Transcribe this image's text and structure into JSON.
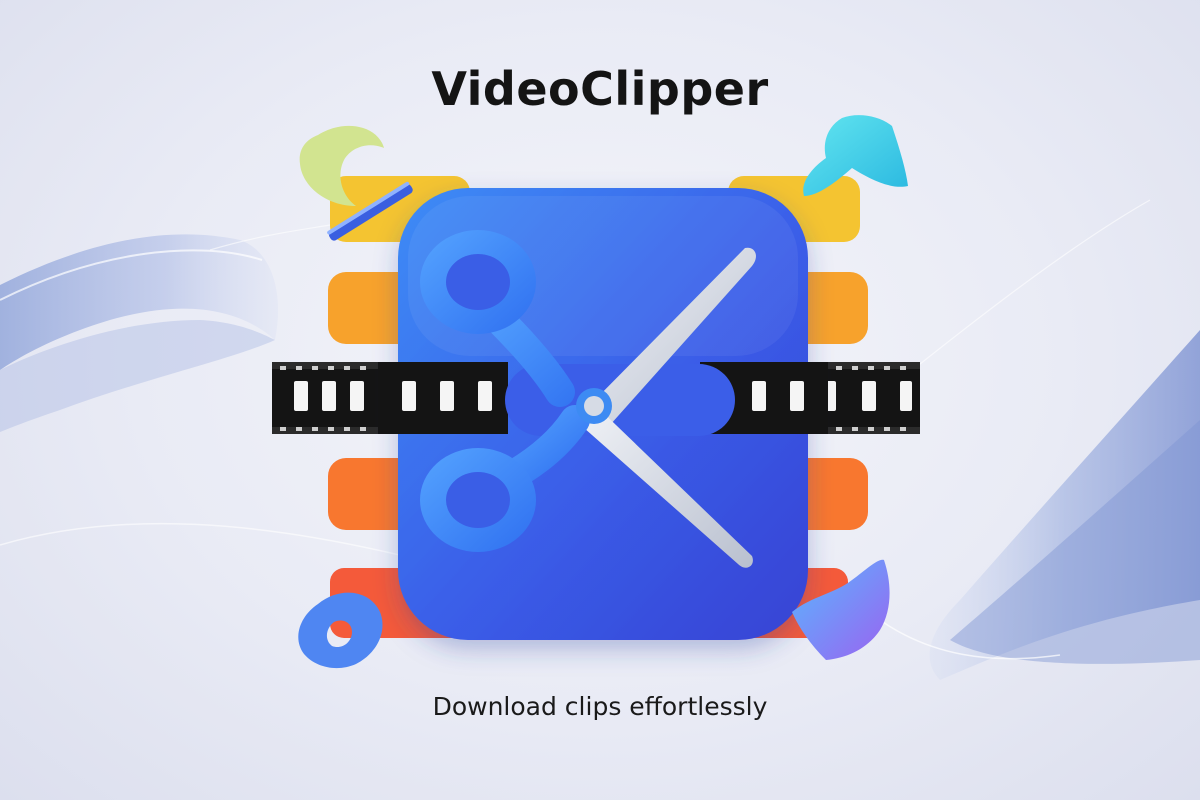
{
  "app": {
    "title": "VideoClipper",
    "tagline": "Download clips effortlessly"
  },
  "icons": {
    "logo": "scissors-cutting-film-strip-icon",
    "decor_top_left": "crescent-shape-icon",
    "decor_top_right": "bowtie-shape-icon",
    "decor_bottom_left": "ring-shape-icon",
    "decor_bottom_right": "wave-shape-icon"
  },
  "colors": {
    "primary_blue": "#3b5ff0",
    "scissor_blue": "#2f7bf2",
    "blade_gray": "#d9dde6",
    "bar_yellow": "#f4c431",
    "bar_orange": "#f7a22c",
    "bar_deep_orange": "#f8772f",
    "bar_red_orange": "#f45a3a",
    "cyan": "#46d4e8",
    "lime": "#cfe28a",
    "purple": "#8f6bf0",
    "title_text": "#141414"
  }
}
